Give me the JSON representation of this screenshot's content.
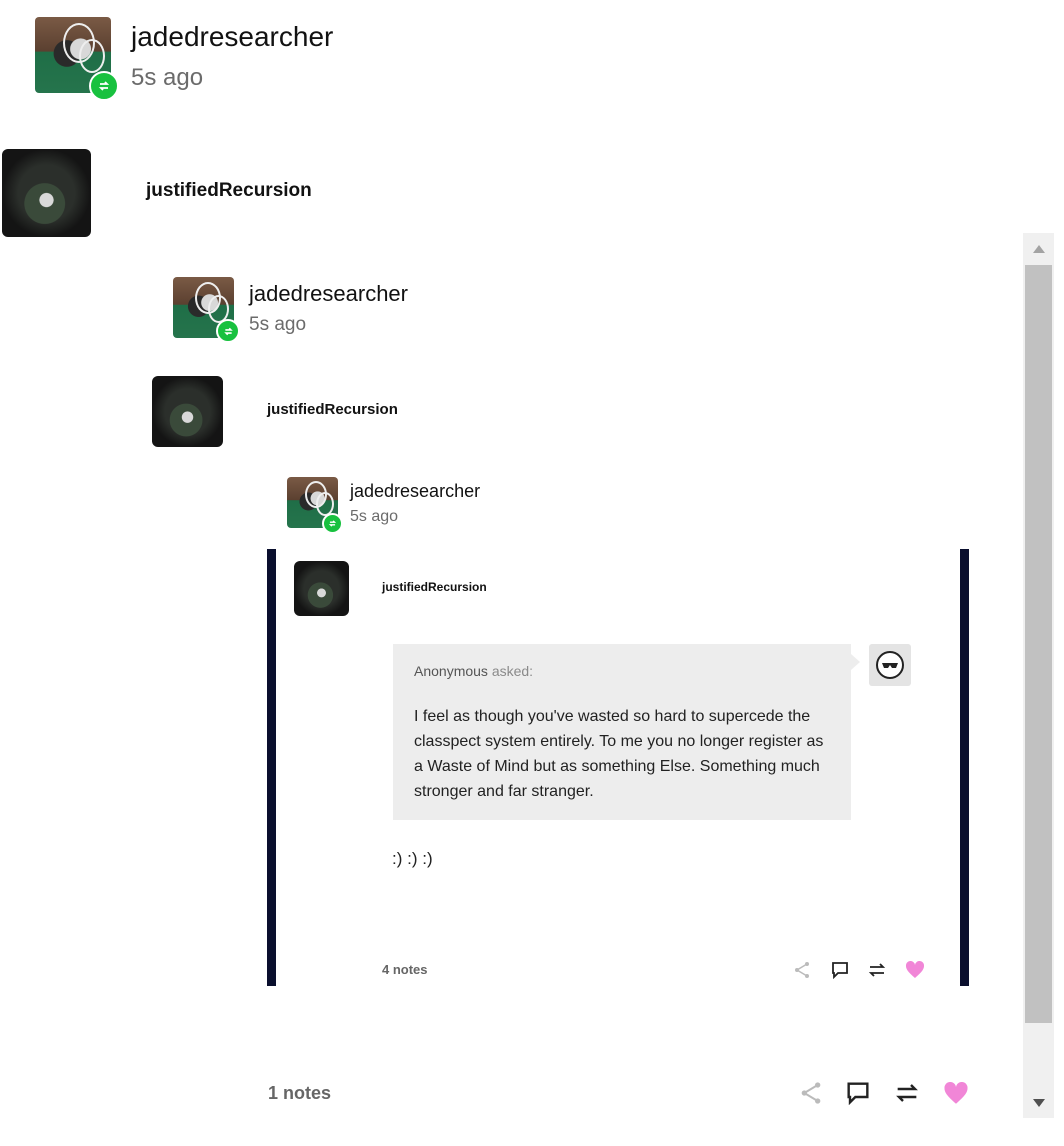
{
  "posts": [
    {
      "username": "jadedresearcher",
      "time": "5s ago"
    },
    {
      "username": "jadedresearcher",
      "time": "5s ago"
    },
    {
      "username": "jadedresearcher",
      "time": "5s ago"
    }
  ],
  "reblogs": [
    {
      "username": "justifiedRecursion"
    },
    {
      "username": "justifiedRecursion"
    },
    {
      "username": "justifiedRecursion"
    }
  ],
  "ask": {
    "asker": "Anonymous",
    "asked_label": "asked:",
    "question": "I feel as though you've wasted so hard to supercede the classpect system entirely. To me you no longer register as a Waste of Mind but as something Else. Something much stronger and far stranger.",
    "answer": ":) :) :)"
  },
  "inner_footer": {
    "notes": "4 notes"
  },
  "outer_footer": {
    "notes": "1 notes"
  },
  "colors": {
    "accent_green": "#18c13f",
    "heart_pink": "#f186d7",
    "quote_bar": "#0a0f2e"
  }
}
